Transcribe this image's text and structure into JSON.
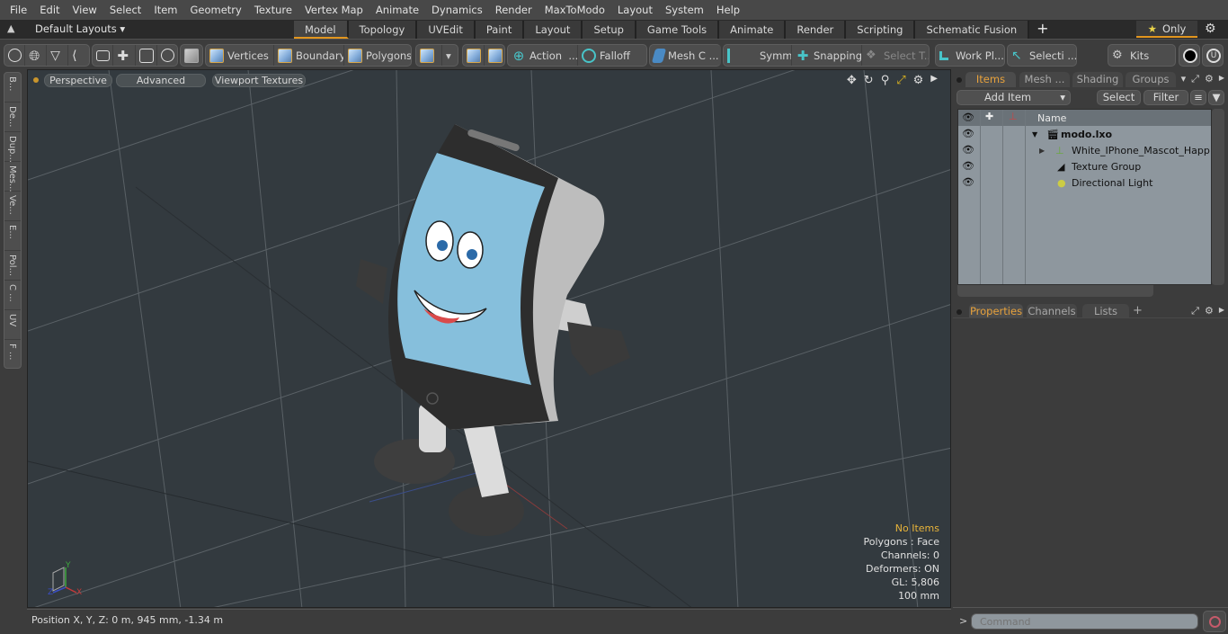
{
  "menu": [
    "File",
    "Edit",
    "View",
    "Select",
    "Item",
    "Geometry",
    "Texture",
    "Vertex Map",
    "Animate",
    "Dynamics",
    "Render",
    "MaxToModo",
    "Layout",
    "System",
    "Help"
  ],
  "layout_bar": {
    "layouts_label": "Default Layouts",
    "tabs": [
      "Model",
      "Topology",
      "UVEdit",
      "Paint",
      "Layout",
      "Setup",
      "Game Tools",
      "Animate",
      "Render",
      "Scripting",
      "Schematic Fusion"
    ],
    "active_tab": "Model",
    "add_tab": "+",
    "only_label": "Only"
  },
  "toolbar": {
    "vertices": "Vertices",
    "boundary": "Boundary",
    "polygons": "Polygons",
    "action": "Action",
    "action_more": "...",
    "falloff": "Falloff",
    "mesh_c": "Mesh C ...",
    "symm": "Symm ...",
    "snapping": "Snapping",
    "select_t": "Select T...",
    "work_pl": "Work Pl...",
    "selecti": "Selecti ...",
    "kits": "Kits"
  },
  "left_tabs": [
    "B...",
    "De...",
    "Dup...",
    "Mes...",
    "Ve...",
    "E...",
    "Pol...",
    "C ...",
    "UV",
    "F ..."
  ],
  "viewport": {
    "buttons": [
      "Perspective",
      "Advanced",
      "Viewport Textures"
    ],
    "hud": {
      "selection": "No Items",
      "polygons": "Polygons : Face",
      "channels": "Channels: 0",
      "deformers": "Deformers: ON",
      "gl": "GL: 5,806",
      "grid": "100 mm"
    },
    "axes": {
      "x": "X",
      "y": "Y",
      "z": "Z"
    }
  },
  "status": {
    "position": "Position X, Y, Z:   0 m, 945 mm, -1.34 m"
  },
  "items_panel": {
    "tabs": [
      "Items",
      "Mesh ...",
      "Shading",
      "Groups"
    ],
    "active_tab": "Items",
    "add_item": "Add Item",
    "select": "Select",
    "filter": "Filter",
    "column_name": "Name",
    "rows": [
      {
        "label": "modo.lxo",
        "level": 0,
        "expanded": true,
        "icon": "scene-icon"
      },
      {
        "label": "White_IPhone_Mascot_Happ ...",
        "level": 1,
        "expanded": false,
        "icon": "locator-icon"
      },
      {
        "label": "Texture Group",
        "level": 1,
        "icon": "texture-group-icon"
      },
      {
        "label": "Directional Light",
        "level": 1,
        "icon": "light-icon"
      }
    ]
  },
  "properties_panel": {
    "tabs": [
      "Properties",
      "Channels",
      "Lists"
    ],
    "active_tab": "Properties",
    "add_tab": "+"
  },
  "command": {
    "prompt": ">",
    "placeholder": "Command"
  },
  "colors": {
    "accent": "#e2961e",
    "viewport_bg": "#333a3f",
    "list_bg": "#8e979e"
  }
}
